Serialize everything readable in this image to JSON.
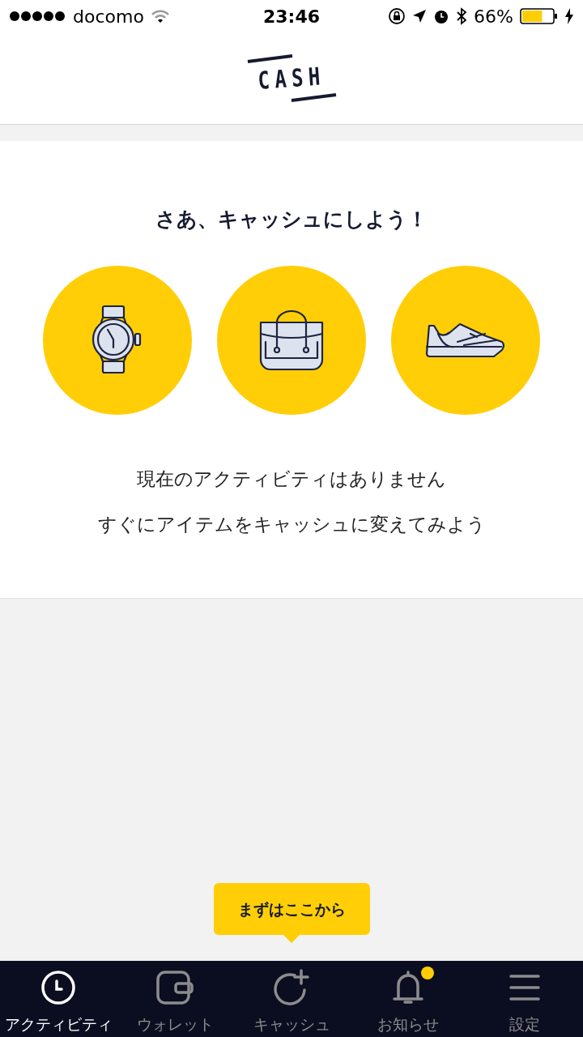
{
  "status_bar": {
    "carrier": "docomo",
    "time": "23:46",
    "battery_percent": "66%",
    "battery": {
      "level": 0.66
    }
  },
  "header": {
    "logo": "CASH"
  },
  "empty_state": {
    "title": "さあ、キャッシュにしよう！",
    "items": [
      {
        "kind": "watch"
      },
      {
        "kind": "bag"
      },
      {
        "kind": "shoe"
      }
    ],
    "lines": [
      "現在のアクティビティはありません",
      "すぐにアイテムをキャッシュに変えてみよう"
    ]
  },
  "tooltip": {
    "text": "まずはここから"
  },
  "tabs": [
    {
      "label": "アクティビティ",
      "kind": "clock",
      "selected": true,
      "badge": false
    },
    {
      "label": "ウォレット",
      "kind": "wallet",
      "selected": false,
      "badge": false
    },
    {
      "label": "キャッシュ",
      "kind": "cash",
      "selected": false,
      "badge": false
    },
    {
      "label": "お知らせ",
      "kind": "bell",
      "selected": false,
      "badge": true
    },
    {
      "label": "設定",
      "kind": "menu",
      "selected": false,
      "badge": false
    }
  ]
}
